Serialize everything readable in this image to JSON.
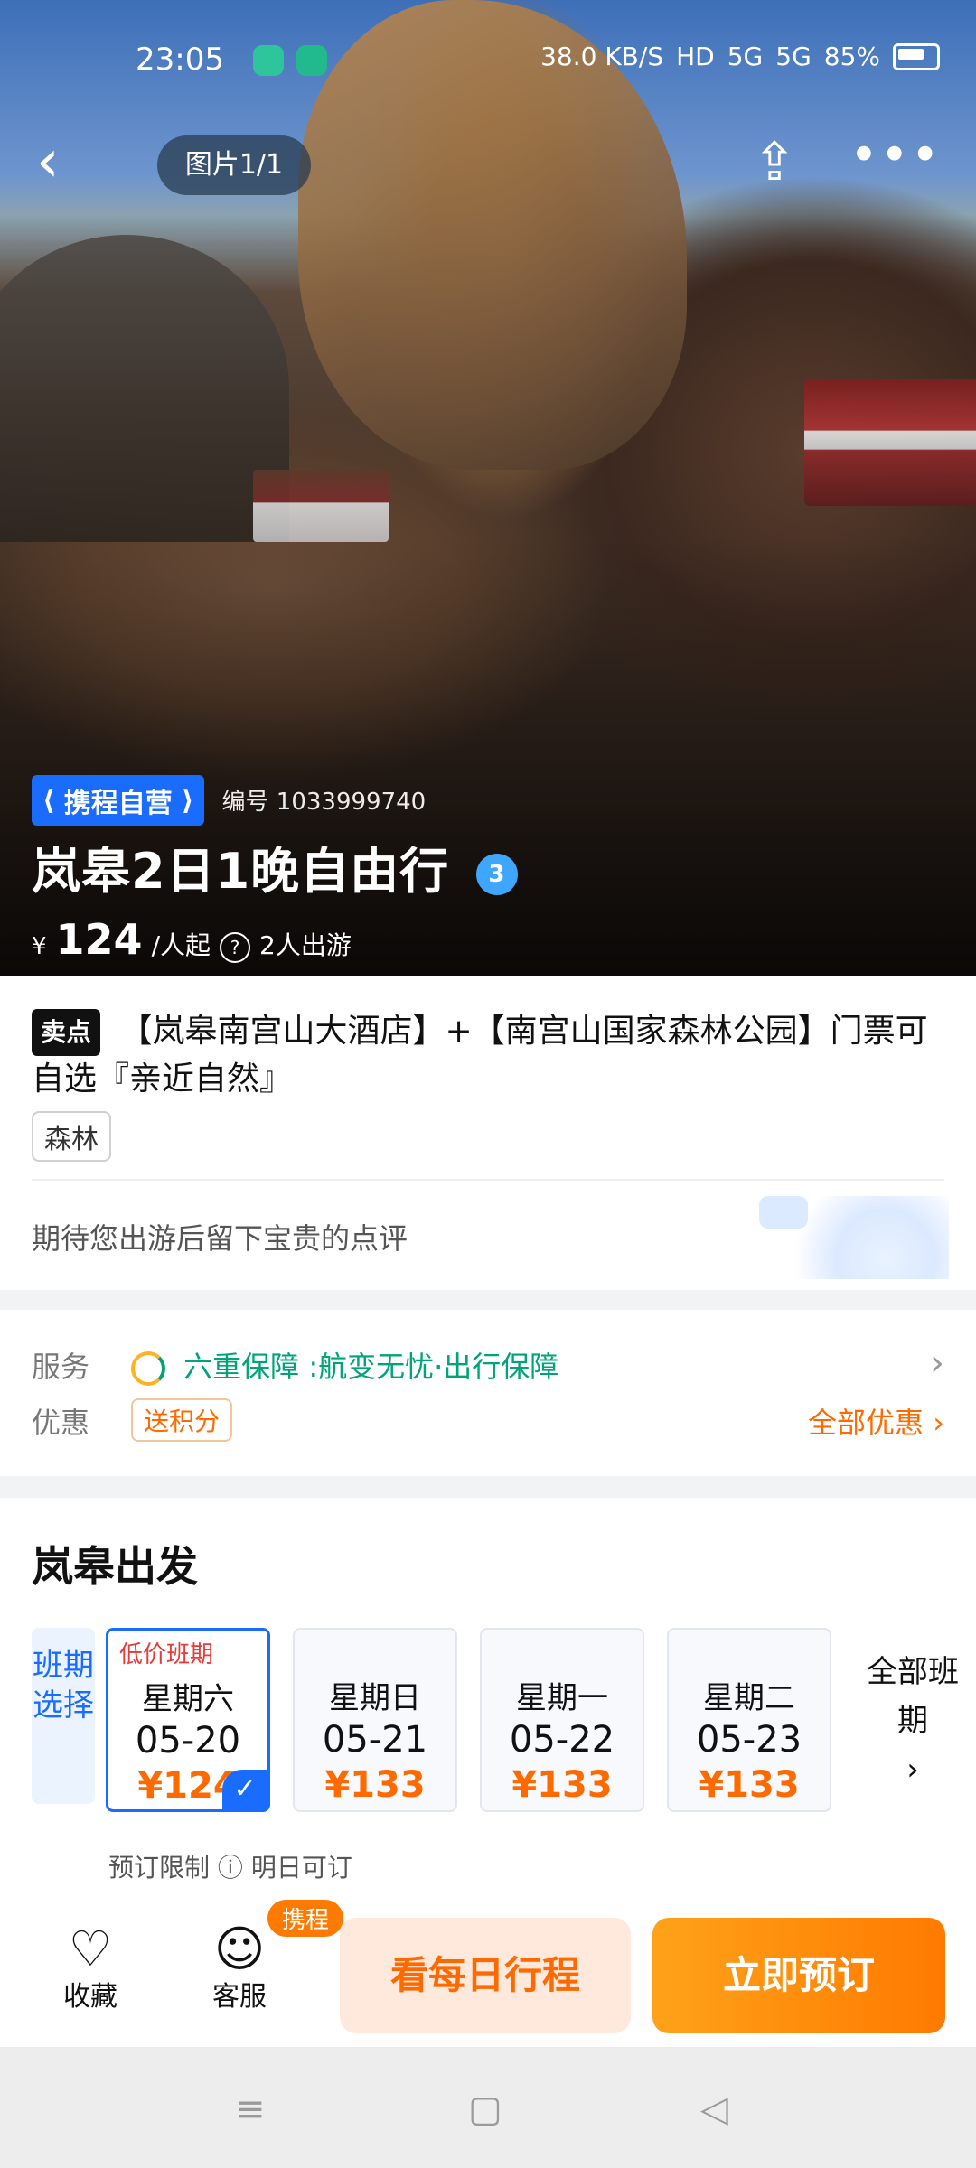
{
  "status_bar": {
    "time": "23:05",
    "net_speed": "38.0 KB/S",
    "hd": "HD",
    "signal_1": "5G",
    "signal_2": "5G",
    "battery": "85%"
  },
  "top_controls": {
    "back_icon": "chevron-left",
    "photo_counter": "图片1/1",
    "share_icon": "share",
    "more_icon": "more"
  },
  "hero": {
    "brand_badge": "携程自营",
    "code": "编号 1033999740",
    "title": "岚皋2日1晚自由行",
    "diamond_level": "3",
    "price_currency": "¥",
    "price_value": "124",
    "price_unit": "/人起",
    "people": "2人出游"
  },
  "sell": {
    "tag": "卖点",
    "text": "【岚皋南宫山大酒店】+【南宫山国家森林公园】门票可自选『亲近自然』",
    "category": "森林",
    "review_prompt": "期待您出游后留下宝贵的点评"
  },
  "service": {
    "service_label": "服务",
    "service_text": "六重保障 :航变无忧·出行保障",
    "offers_label": "优惠",
    "coupon": "送积分",
    "all_offers": "全部优惠"
  },
  "departure": {
    "title": "岚皋出发",
    "side_label": "班期选择",
    "low_price_tag": "低价班期",
    "dates": [
      {
        "weekday": "星期六",
        "date": "05-20",
        "price": "¥124"
      },
      {
        "weekday": "星期日",
        "date": "05-21",
        "price": "¥133"
      },
      {
        "weekday": "星期一",
        "date": "05-22",
        "price": "¥133"
      },
      {
        "weekday": "星期二",
        "date": "05-23",
        "price": "¥133"
      }
    ],
    "all_schedules": "全部班期",
    "booking_limit": "预订限制",
    "booking_hint": "明日可订"
  },
  "bottom_bar": {
    "favorite": "收藏",
    "customer_service": "客服",
    "ctrip_badge": "携程",
    "itinerary_button": "看每日行程",
    "book_button": "立即预订"
  },
  "colors": {
    "accent_blue": "#1a6cff",
    "orange": "#ff6a00",
    "green": "#00a37a"
  }
}
